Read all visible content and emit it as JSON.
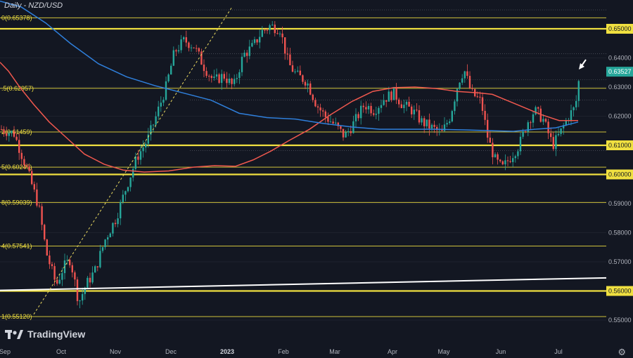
{
  "title": "Daily - NZD/USD",
  "logo_text": "TradingView",
  "icons": {
    "settings": "gear-icon",
    "logo": "tradingview-logo-icon"
  },
  "colors": {
    "background": "#131722",
    "candle_up": "#26a69a",
    "candle_down": "#ef5350",
    "ma_fast": "#f0584e",
    "ma_slow": "#2f7fdb",
    "fib": "#f0e040",
    "trendline": "#ffffff"
  },
  "chart_data": {
    "type": "candlestick",
    "title": "Daily - NZD/USD",
    "ylim": [
      0.5495,
      0.6585
    ],
    "price_axis_ticks": [
      "0.65000",
      "0.64000",
      "0.63527",
      "0.63000",
      "0.62000",
      "0.61000",
      "0.60000",
      "0.59000",
      "0.58000",
      "0.57000",
      "0.56000",
      "0.55000"
    ],
    "current_price": "0.63527",
    "time_axis_labels": [
      "Sep",
      "Oct",
      "Nov",
      "Dec",
      "2023",
      "Feb",
      "Mar",
      "Apr",
      "May",
      "Jun",
      "Jul"
    ],
    "fib_levels": [
      {
        "label": "0(0.65378)",
        "value": 0.65378
      },
      {
        "label": ".5(0.62957)",
        "value": 0.62957
      },
      {
        "label": "2(0.61459)",
        "value": 0.61459
      },
      {
        "label": "5(0.60249)",
        "value": 0.60249
      },
      {
        "label": "8(0.59039)",
        "value": 0.59039
      },
      {
        "label": "4(0.57541)",
        "value": 0.57541
      },
      {
        "label": "1(0.55120)",
        "value": 0.5512
      }
    ],
    "horizontal_levels": [
      0.65,
      0.61,
      0.6,
      0.56
    ],
    "series": [
      {
        "name": "",
        "kind": "moving_average_fast",
        "points": [
          [
            0,
            0.6385
          ],
          [
            12,
            0.6355
          ],
          [
            28,
            0.63
          ],
          [
            48,
            0.624
          ],
          [
            70,
            0.618
          ],
          [
            95,
            0.6125
          ],
          [
            120,
            0.607
          ],
          [
            148,
            0.6035
          ],
          [
            175,
            0.6015
          ],
          [
            205,
            0.6008
          ],
          [
            240,
            0.6012
          ],
          [
            275,
            0.6025
          ],
          [
            305,
            0.603
          ],
          [
            335,
            0.6028
          ],
          [
            360,
            0.605
          ],
          [
            385,
            0.608
          ],
          [
            410,
            0.6115
          ],
          [
            440,
            0.6155
          ],
          [
            470,
            0.6205
          ],
          [
            500,
            0.625
          ],
          [
            530,
            0.6285
          ],
          [
            560,
            0.6298
          ],
          [
            590,
            0.63
          ],
          [
            620,
            0.6295
          ],
          [
            650,
            0.6285
          ],
          [
            680,
            0.628
          ],
          [
            700,
            0.6275
          ],
          [
            720,
            0.6255
          ],
          [
            745,
            0.623
          ],
          [
            770,
            0.6205
          ],
          [
            795,
            0.6185
          ],
          [
            822,
            0.6185
          ]
        ]
      },
      {
        "name": "",
        "kind": "moving_average_slow",
        "points": [
          [
            0,
            0.6595
          ],
          [
            30,
            0.6575
          ],
          [
            65,
            0.652
          ],
          [
            100,
            0.645
          ],
          [
            140,
            0.638
          ],
          [
            180,
            0.6335
          ],
          [
            220,
            0.6305
          ],
          [
            260,
            0.628
          ],
          [
            300,
            0.6255
          ],
          [
            340,
            0.621
          ],
          [
            380,
            0.6195
          ],
          [
            420,
            0.619
          ],
          [
            460,
            0.6175
          ],
          [
            500,
            0.6163
          ],
          [
            540,
            0.6155
          ],
          [
            580,
            0.6155
          ],
          [
            620,
            0.6155
          ],
          [
            660,
            0.6153
          ],
          [
            700,
            0.615
          ],
          [
            730,
            0.6148
          ],
          [
            760,
            0.6155
          ],
          [
            790,
            0.616
          ],
          [
            822,
            0.618
          ]
        ]
      }
    ],
    "trendline": {
      "from": [
        0,
        0.5602
      ],
      "to": [
        862,
        0.5645
      ]
    },
    "dashed_trendline": {
      "from": [
        48,
        0.552
      ],
      "to": [
        330,
        0.6575
      ]
    },
    "annotation": "arrow pointing to latest candle"
  }
}
